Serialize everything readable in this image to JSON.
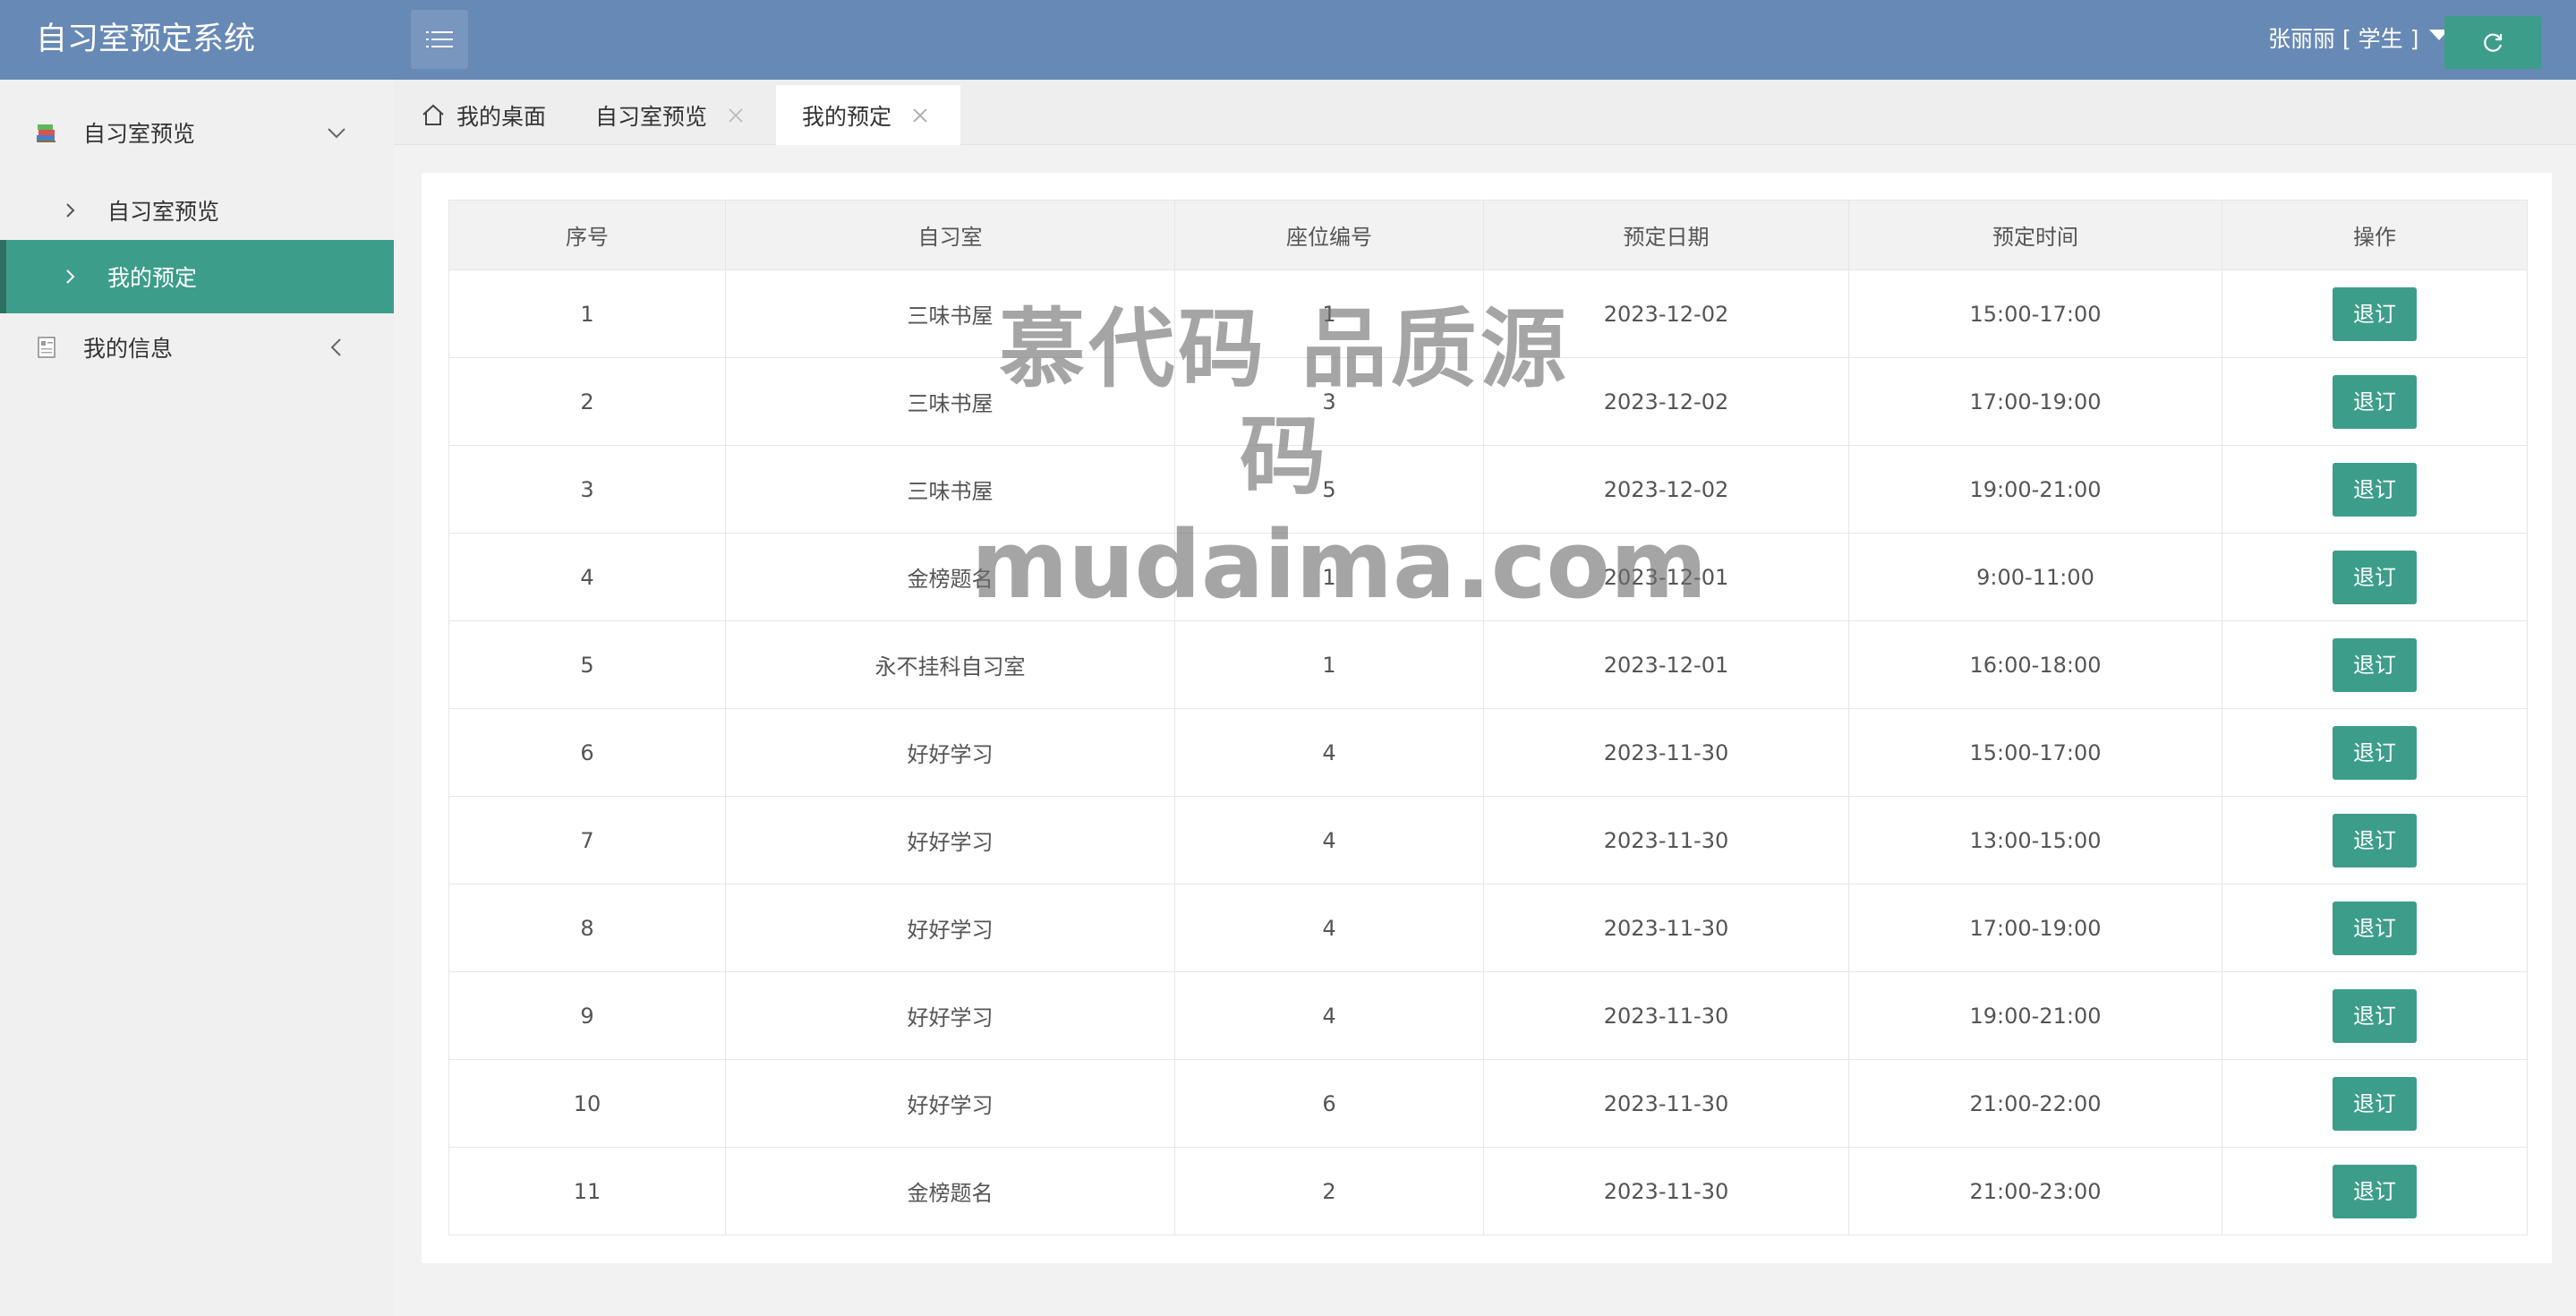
{
  "header": {
    "app_title": "自习室预定系统",
    "user_label": "张丽丽 [ 学生 ]"
  },
  "sidebar": {
    "groups": [
      {
        "label": "自习室预览",
        "icon": "books-icon",
        "expanded": true,
        "items": [
          {
            "label": "自习室预览"
          },
          {
            "label": "我的预定",
            "active": true
          }
        ]
      },
      {
        "label": "我的信息",
        "icon": "profile-card-icon",
        "expanded": false
      }
    ]
  },
  "tabs": [
    {
      "label": "我的桌面",
      "icon": "home-icon",
      "closable": false
    },
    {
      "label": "自习室预览",
      "closable": true
    },
    {
      "label": "我的预定",
      "closable": true,
      "active": true
    }
  ],
  "table": {
    "columns": [
      "序号",
      "自习室",
      "座位编号",
      "预定日期",
      "预定时间",
      "操作"
    ],
    "action_label": "退订",
    "rows": [
      [
        "1",
        "三味书屋",
        "1",
        "2023-12-02",
        "15:00-17:00"
      ],
      [
        "2",
        "三味书屋",
        "3",
        "2023-12-02",
        "17:00-19:00"
      ],
      [
        "3",
        "三味书屋",
        "5",
        "2023-12-02",
        "19:00-21:00"
      ],
      [
        "4",
        "金榜题名",
        "1",
        "2023-12-01",
        "9:00-11:00"
      ],
      [
        "5",
        "永不挂科自习室",
        "1",
        "2023-12-01",
        "16:00-18:00"
      ],
      [
        "6",
        "好好学习",
        "4",
        "2023-11-30",
        "15:00-17:00"
      ],
      [
        "7",
        "好好学习",
        "4",
        "2023-11-30",
        "13:00-15:00"
      ],
      [
        "8",
        "好好学习",
        "4",
        "2023-11-30",
        "17:00-19:00"
      ],
      [
        "9",
        "好好学习",
        "4",
        "2023-11-30",
        "19:00-21:00"
      ],
      [
        "10",
        "好好学习",
        "6",
        "2023-11-30",
        "21:00-22:00"
      ],
      [
        "11",
        "金榜题名",
        "2",
        "2023-11-30",
        "21:00-23:00"
      ]
    ]
  },
  "watermark": {
    "line1": "慕代码 品质源码",
    "line2": "mudaima.com"
  },
  "colors": {
    "header_bg": "#6789b5",
    "accent_green": "#3d9d8b",
    "sidebar_bg": "#f0f0f0"
  }
}
